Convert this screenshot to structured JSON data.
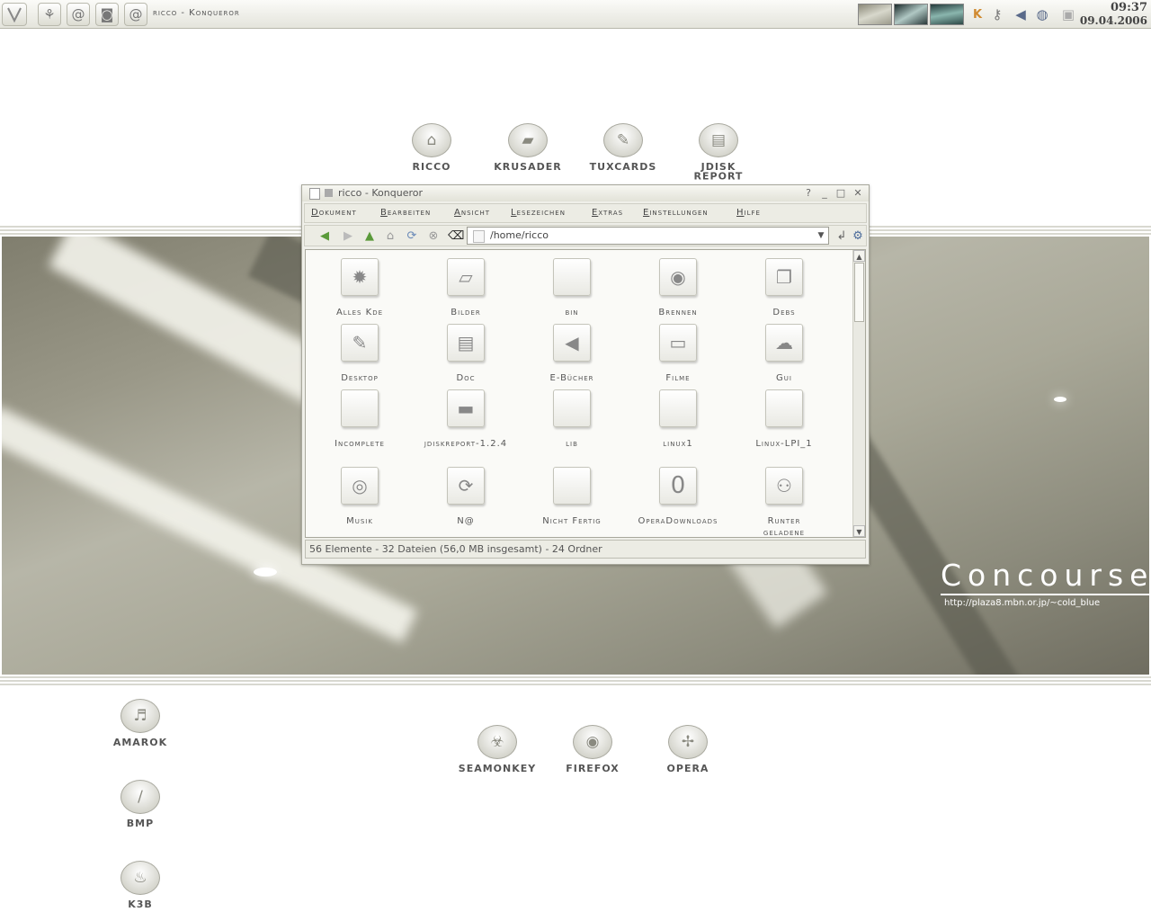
{
  "taskbar": {
    "window_title": "ricco - Konqueror",
    "launchers": [
      {
        "icon": "kde-menu-icon"
      },
      {
        "icon": "run-icon",
        "glyph": "⚘"
      },
      {
        "icon": "at-icon",
        "glyph": "@"
      },
      {
        "icon": "screen-icon",
        "glyph": "◙"
      },
      {
        "icon": "at-icon",
        "glyph": "@"
      }
    ],
    "clock": {
      "time": "09:37",
      "date": "09.04.2006"
    }
  },
  "desktop_icons": [
    {
      "label": "RICCO",
      "glyph": "⌂"
    },
    {
      "label": "KRUSADER",
      "glyph": "▰"
    },
    {
      "label": "TUXCARDS",
      "glyph": "✎"
    },
    {
      "label": "JDISK REPORT",
      "glyph": "▤"
    },
    {
      "label": "AMAROK",
      "glyph": "♬"
    },
    {
      "label": "BMP",
      "glyph": "∕"
    },
    {
      "label": "K3B",
      "glyph": "♨"
    },
    {
      "label": "SEAMONKEY",
      "glyph": "☣"
    },
    {
      "label": "FIREFOX",
      "glyph": "◉"
    },
    {
      "label": "OPERA",
      "glyph": "✢"
    }
  ],
  "wallpaper": {
    "title": "Concourse",
    "url": "http://plaza8.mbn.or.jp/~cold_blue"
  },
  "konqueror": {
    "title": "ricco - Konqueror",
    "menu": [
      "Dokument",
      "Bearbeiten",
      "Ansicht",
      "Lesezeichen",
      "Extras",
      "Einstellungen",
      "Hilfe"
    ],
    "address": "/home/ricco",
    "files": [
      {
        "name": "Alles Kde",
        "glyph": "✹"
      },
      {
        "name": "Bilder",
        "glyph": "▱"
      },
      {
        "name": "bin",
        "glyph": ""
      },
      {
        "name": "Brennen",
        "glyph": "◉"
      },
      {
        "name": "Debs",
        "glyph": "❐"
      },
      {
        "name": "Desktop",
        "glyph": "✎"
      },
      {
        "name": "Doc",
        "glyph": "▤"
      },
      {
        "name": "E-Bücher",
        "glyph": "◀"
      },
      {
        "name": "Filme",
        "glyph": "▭"
      },
      {
        "name": "Gui",
        "glyph": "☁"
      },
      {
        "name": "Incomplete",
        "glyph": ""
      },
      {
        "name": "jdiskreport-1.2.4",
        "glyph": "▬"
      },
      {
        "name": "lib",
        "glyph": ""
      },
      {
        "name": "linux1",
        "glyph": ""
      },
      {
        "name": "Linux-LPI_1",
        "glyph": ""
      },
      {
        "name": "Musik",
        "glyph": "◎"
      },
      {
        "name": "N@",
        "glyph": "⟳"
      },
      {
        "name": "Nicht Fertig",
        "glyph": ""
      },
      {
        "name": "OperaDownloads",
        "glyph": "0"
      },
      {
        "name": "Runter geladene",
        "glyph": "⚇"
      }
    ],
    "status": "56 Elemente - 32 Dateien (56,0 MB insgesamt) - 24 Ordner"
  }
}
